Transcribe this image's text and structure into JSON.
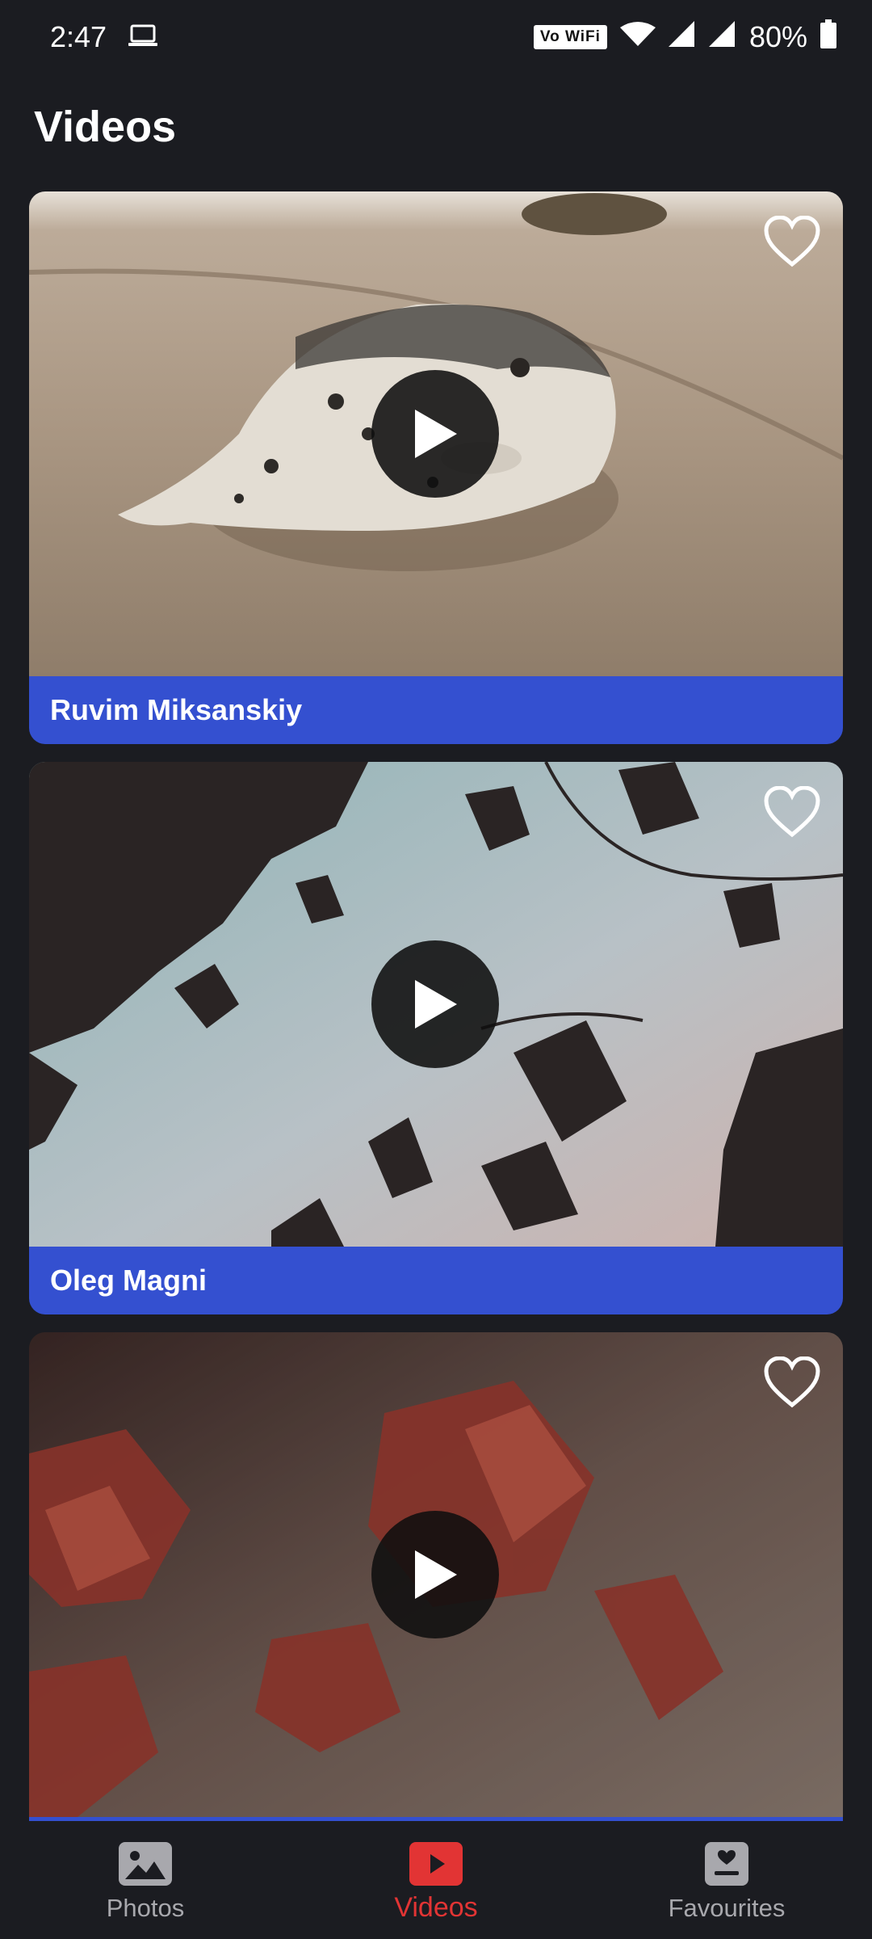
{
  "status_bar": {
    "time": "2:47",
    "vowifi": "Vo WiFi",
    "battery": "80%"
  },
  "app_bar": {
    "title": "Videos"
  },
  "videos": [
    {
      "author": "Ruvim Miksanskiy",
      "thumbnail": "seal-on-beach"
    },
    {
      "author": "Oleg Magni",
      "thumbnail": "dark-leaves-against-sky"
    },
    {
      "author": "",
      "thumbnail": "red-maple-leaves"
    }
  ],
  "bottom_nav": {
    "items": [
      {
        "label": "Photos",
        "icon": "image-icon",
        "active": false
      },
      {
        "label": "Videos",
        "icon": "youtube-icon",
        "active": true
      },
      {
        "label": "Favourites",
        "icon": "favourites-icon",
        "active": false
      }
    ]
  },
  "colors": {
    "background": "#1b1c21",
    "card_footer": "#3450d0",
    "active_nav": "#e23434",
    "inactive_nav": "#a8a8ad"
  }
}
